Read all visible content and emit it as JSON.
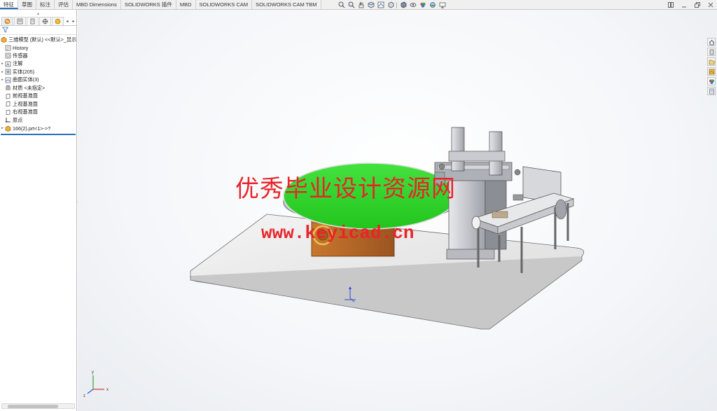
{
  "tabs": [
    {
      "label": "特征",
      "active": true
    },
    {
      "label": "草图"
    },
    {
      "label": "标注"
    },
    {
      "label": "评估"
    },
    {
      "label": "MBD Dimensions"
    },
    {
      "label": "SOLIDWORKS 插件"
    },
    {
      "label": "MBD"
    },
    {
      "label": "SOLIDWORKS CAM"
    },
    {
      "label": "SOLIDWORKS CAM TBM"
    }
  ],
  "view_toolbar_icons": [
    "zoom-to-fit-icon",
    "zoom-area-icon",
    "previous-view-icon",
    "section-view-icon",
    "dynamic-annotation-icon",
    "view-orientation-icon",
    "display-style-icon",
    "hide-show-items-icon",
    "edit-appearance-icon",
    "apply-scene-icon",
    "view-settings-icon"
  ],
  "feature_tree": {
    "root": "三维模型 (默认) <<默认>_显示",
    "items": [
      {
        "label": "History",
        "icon": "history-icon",
        "expandable": false
      },
      {
        "label": "传感器",
        "icon": "sensors-icon",
        "expandable": false
      },
      {
        "label": "注解",
        "icon": "annotations-icon",
        "expandable": true
      },
      {
        "label": "实体(205)",
        "icon": "solid-bodies-icon",
        "expandable": true
      },
      {
        "label": "曲面实体(3)",
        "icon": "surface-bodies-icon",
        "expandable": true
      },
      {
        "label": "材质 <未指定>",
        "icon": "material-icon",
        "expandable": false
      },
      {
        "label": "前视基准面",
        "icon": "plane-icon",
        "expandable": false
      },
      {
        "label": "上视基准面",
        "icon": "plane-icon",
        "expandable": false
      },
      {
        "label": "右视基准面",
        "icon": "plane-icon",
        "expandable": false
      },
      {
        "label": "原点",
        "icon": "origin-icon",
        "expandable": false
      },
      {
        "label": "166(2).prt<1>->?",
        "icon": "part-icon",
        "expandable": true
      }
    ]
  },
  "watermark": {
    "title": "优秀毕业设计资源网",
    "url": "www.keyicad.cn"
  },
  "colors": {
    "turntable_top": "#2fd52b",
    "base_box": "#b8692a",
    "watermark": "#e8242a",
    "accent": "#2a6ebb"
  },
  "triad": {
    "x": "x",
    "y": "y",
    "z": "z"
  }
}
